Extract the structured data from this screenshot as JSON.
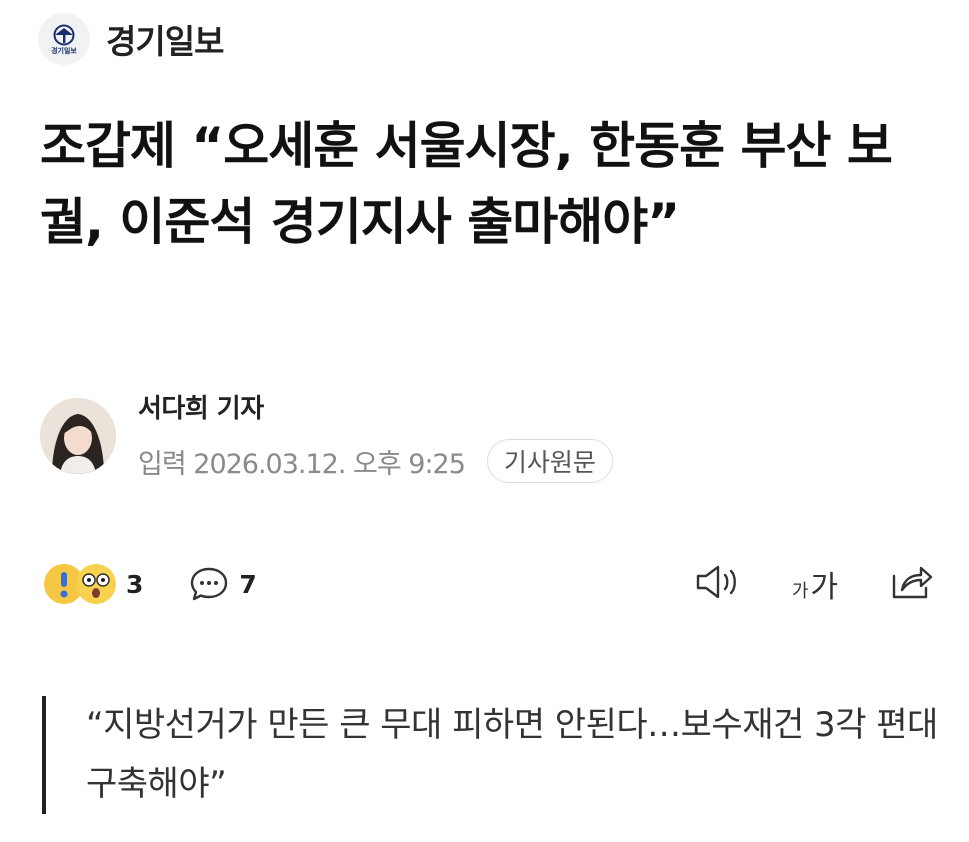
{
  "publisher": {
    "name": "경기일보",
    "logo_text": "경기일보"
  },
  "article": {
    "headline": "조갑제 “오세훈 서울시장, 한동훈 부산 보궐, 이준석 경기지사 출마해야”",
    "reporter": "서다희 기자",
    "published": "입력 2026.03.12. 오후 9:25",
    "original_button": "기사원문",
    "subtitle": "“지방선거가 만든 큰 무대 피하면 안된다…보수재건 3각 편대 구축해야”"
  },
  "actions": {
    "reaction_count": "3",
    "comment_count": "7",
    "font_small": "가",
    "font_large": "가",
    "icons": [
      "reaction-surprised-icon",
      "reaction-shocked-icon",
      "comment-icon",
      "speaker-icon",
      "font-size-icon",
      "share-icon"
    ]
  }
}
